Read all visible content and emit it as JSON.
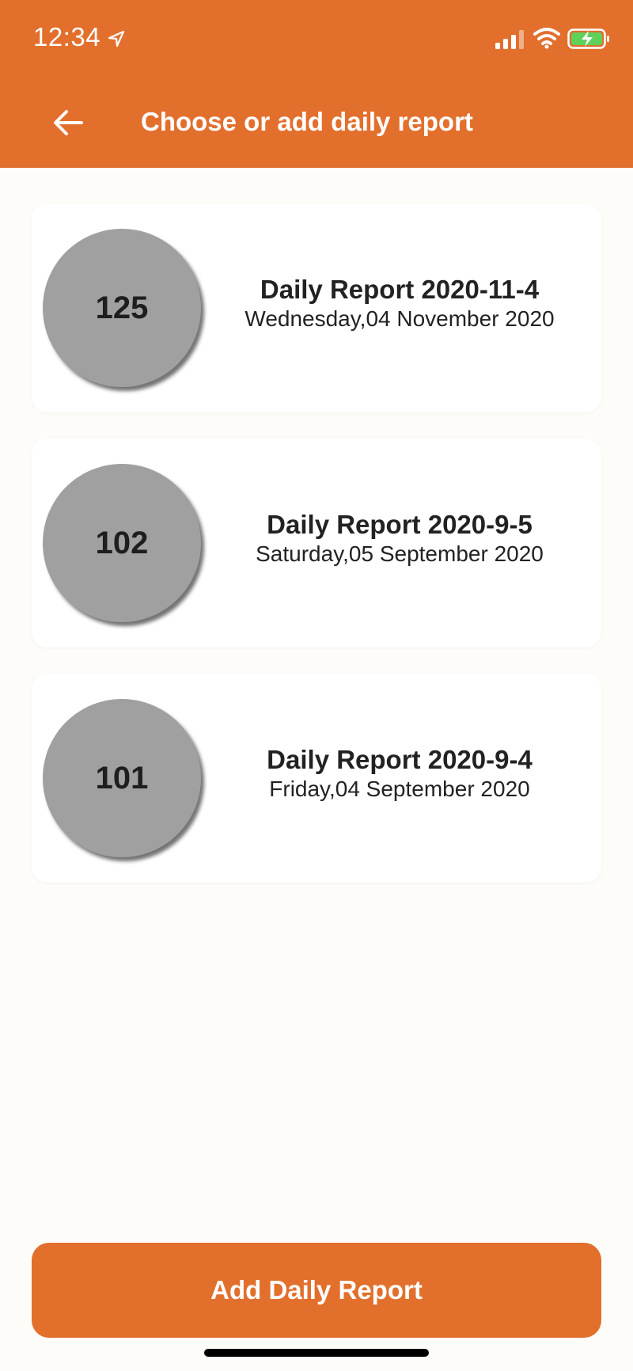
{
  "status_bar": {
    "time": "12:34"
  },
  "header": {
    "title": "Choose or add daily report",
    "back_icon": "arrow-left-icon"
  },
  "reports": [
    {
      "count": "125",
      "title": "Daily Report 2020-11-4",
      "date": "Wednesday,04 November 2020"
    },
    {
      "count": "102",
      "title": "Daily Report 2020-9-5",
      "date": "Saturday,05 September 2020"
    },
    {
      "count": "101",
      "title": "Daily Report 2020-9-4",
      "date": "Friday,04 September 2020"
    }
  ],
  "footer": {
    "add_label": "Add Daily Report"
  },
  "colors": {
    "accent": "#e36f2d",
    "background": "#fdfcf8",
    "circle": "#a0a0a0"
  }
}
